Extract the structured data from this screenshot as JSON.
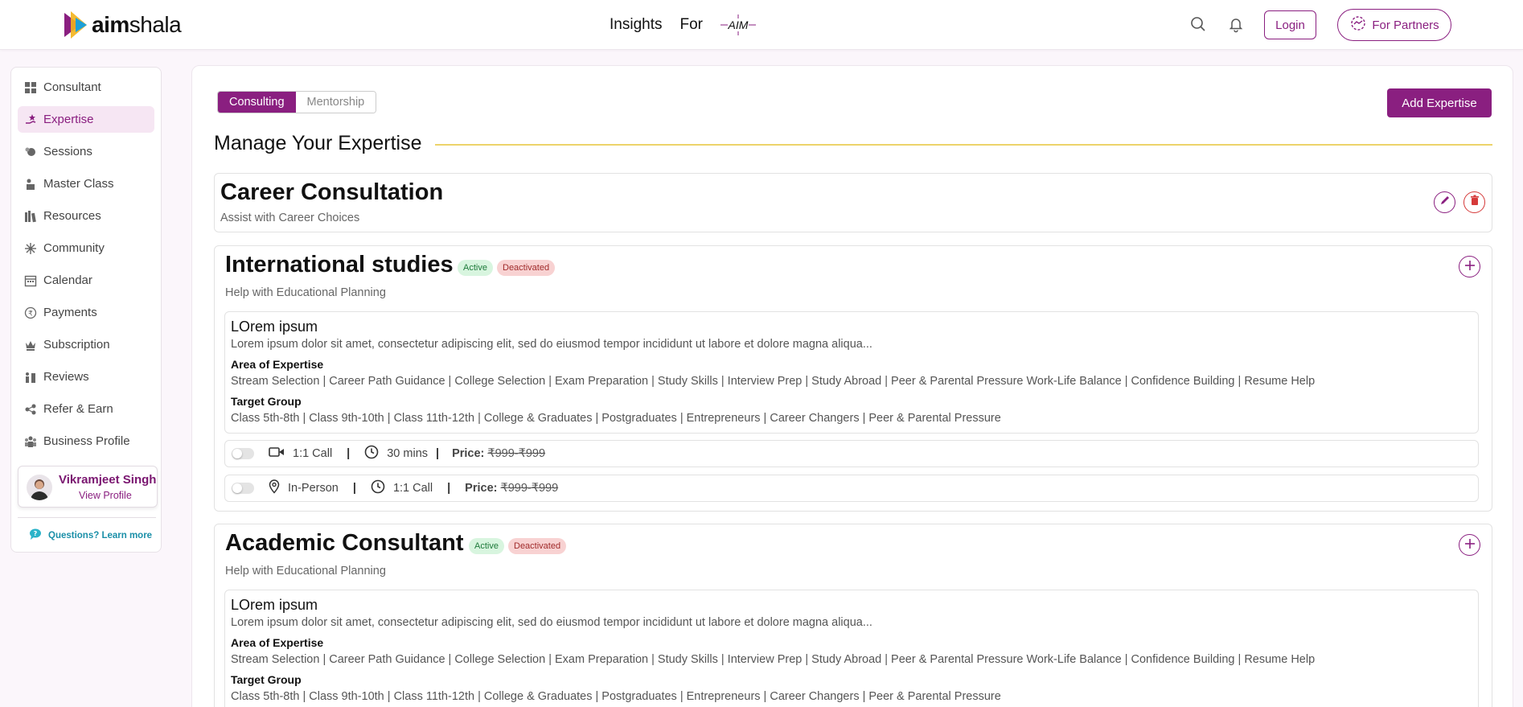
{
  "header": {
    "logo_text_bold": "aim",
    "logo_text_rest": "shala",
    "nav": [
      "Insights",
      "For"
    ],
    "aim_badge": "AIM",
    "login_label": "Login",
    "partners_label": "For Partners"
  },
  "sidebar": {
    "items": [
      {
        "label": "Consultant",
        "icon": "grid-icon"
      },
      {
        "label": "Expertise",
        "icon": "hand-star-icon"
      },
      {
        "label": "Sessions",
        "icon": "sessions-icon"
      },
      {
        "label": "Master Class",
        "icon": "presenter-icon"
      },
      {
        "label": "Resources",
        "icon": "books-icon"
      },
      {
        "label": "Community",
        "icon": "community-icon"
      },
      {
        "label": "Calendar",
        "icon": "calendar-icon"
      },
      {
        "label": "Payments",
        "icon": "rupee-icon"
      },
      {
        "label": "Subscription",
        "icon": "crown-icon"
      },
      {
        "label": "Reviews",
        "icon": "reviews-icon"
      },
      {
        "label": "Refer & Earn",
        "icon": "refer-icon"
      },
      {
        "label": "Business Profile",
        "icon": "team-icon"
      }
    ],
    "active_index": 1,
    "profile": {
      "name": "Vikramjeet Singh",
      "link": "View Profile"
    },
    "help": "Questions? Learn more"
  },
  "main": {
    "tabs": [
      "Consulting",
      "Mentorship"
    ],
    "active_tab": 0,
    "add_button": "Add Expertise",
    "title": "Manage Your Expertise",
    "career": {
      "title": "Career Consultation",
      "subtitle": "Assist with Career Choices"
    },
    "cards": [
      {
        "title": "International studies",
        "badge_active": "Active",
        "badge_deactivated": "Deactivated",
        "subtitle": "Help with Educational Planning",
        "inner_title": "LOrem ipsum",
        "inner_desc": "Lorem ipsum dolor sit amet, consectetur adipiscing elit, sed do eiusmod tempor incididunt ut labore et dolore magna aliqua...",
        "area_label": "Area of Expertise",
        "area_value": "Stream Selection | Career Path Guidance | College Selection | Exam Preparation | Study Skills | Interview Prep | Study Abroad | Peer & Parental Pressure Work-Life Balance | Confidence Building | Resume Help",
        "target_label": "Target Group",
        "target_value": "Class 5th-8th | Class 9th-10th | Class 11th-12th | College & Graduates | Postgraduates | Entrepreneurs | Career Changers | Peer & Parental Pressure",
        "option1": {
          "mode": "1:1 Call",
          "duration": "30 mins",
          "price_label": "Price:",
          "price": "₹999-₹999"
        },
        "option2": {
          "mode": "In-Person",
          "duration": "1:1 Call",
          "price_label": "Price:",
          "price": "₹999-₹999"
        }
      },
      {
        "title": "Academic Consultant",
        "badge_active": "Active",
        "badge_deactivated": "Deactivated",
        "subtitle": "Help with Educational Planning",
        "inner_title": "LOrem ipsum",
        "inner_desc": "Lorem ipsum dolor sit amet, consectetur adipiscing elit, sed do eiusmod tempor incididunt ut labore et dolore magna aliqua...",
        "area_label": "Area of Expertise",
        "area_value": "Stream Selection | Career Path Guidance | College Selection | Exam Preparation | Study Skills | Interview Prep | Study Abroad | Peer & Parental Pressure Work-Life Balance | Confidence Building | Resume Help",
        "target_label": "Target Group",
        "target_value": "Class 5th-8th | Class 9th-10th | Class 11th-12th | College & Graduates | Postgraduates | Entrepreneurs | Career Changers | Peer & Parental Pressure"
      }
    ]
  },
  "colors": {
    "brand": "#8a1f80",
    "accent_line": "#ecd36a",
    "active_bg": "#d8f5df",
    "deactivated_bg": "#f8d2d2"
  }
}
